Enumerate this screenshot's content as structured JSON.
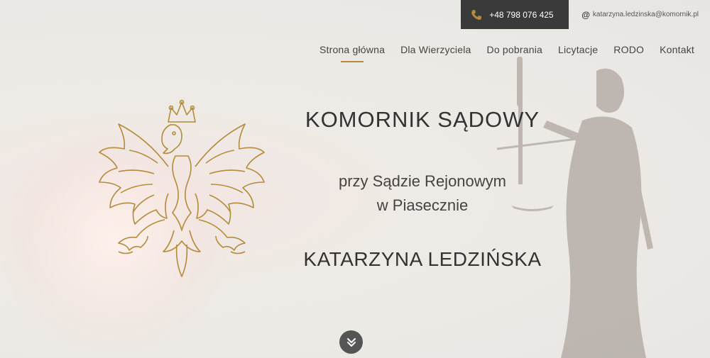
{
  "contact": {
    "phone": "+48 798 076 425",
    "email": "katarzyna.ledzinska@komornik.pl"
  },
  "nav": {
    "items": [
      "Strona główna",
      "Dla Wierzyciela",
      "Do pobrania",
      "Licytacje",
      "RODO",
      "Kontakt"
    ],
    "active_index": 0
  },
  "hero": {
    "title": "KOMORNIK SĄDOWY",
    "subtitle_line1": "przy Sądzie Rejonowym",
    "subtitle_line2": "w Piasecznie",
    "name": "KATARZYNA LEDZIŃSKA"
  },
  "icons": {
    "phone": "phone-icon",
    "email": "at-icon",
    "emblem": "polish-eagle-emblem",
    "scroll": "double-chevron-down-icon"
  },
  "colors": {
    "accent_gold": "#b38b3a",
    "dark": "#3a3a3a"
  }
}
